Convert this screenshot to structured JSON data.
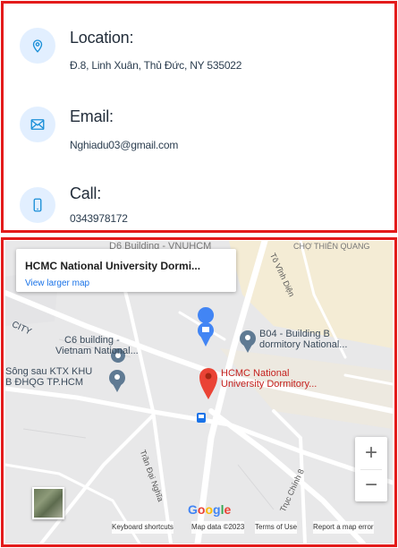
{
  "contact": {
    "location": {
      "icon": "location-pin-icon",
      "title": "Location:",
      "text": "Đ.8, Linh Xuân, Thủ Đức, NY 535022"
    },
    "email": {
      "icon": "envelope-icon",
      "title": "Email:",
      "text": "Nghiadu03@gmail.com"
    },
    "call": {
      "icon": "phone-icon",
      "title": "Call:",
      "text": "0343978172"
    }
  },
  "colors": {
    "frame": "#e31b1b",
    "icon_bg": "#e2efff",
    "icon_stroke": "#1a8fd8",
    "link": "#1a73e8",
    "pin": "#ea4335"
  },
  "map": {
    "card_title": "HCMC National University Dormi...",
    "card_link": "View larger map",
    "labels": {
      "top_building": "D6 Building - VNUHCM",
      "top_right": "CHỢ THIÊN QUANG",
      "city": "CITY",
      "c6_line1": "C6 building -",
      "c6_line2": "Vietnam National...",
      "ktx_line1": "Sông sau KTX KHU",
      "ktx_line2": "B ĐHQG TP.HCM",
      "b04_line1": "B04 - Building B",
      "b04_line2": "dormitory National...",
      "pin_line1": "HCMC National",
      "pin_line2": "University Dormitory...",
      "road_vinh_dien": "Tô Vĩnh Diện",
      "road_chinh_8": "Trục Chính 8",
      "road_an_dai_nghia": "Trần Đại Nghĩa"
    },
    "zoom_in": "+",
    "zoom_out": "−",
    "google": "Google",
    "attribution": {
      "shortcuts": "Keyboard shortcuts",
      "map_data": "Map data ©2023",
      "terms": "Terms of Use",
      "report": "Report a map error"
    }
  }
}
